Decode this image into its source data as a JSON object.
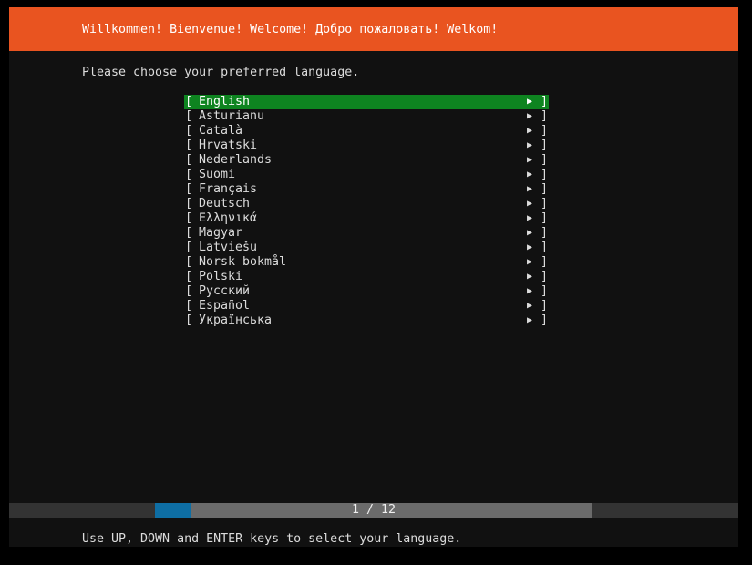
{
  "header": {
    "title": "Willkommen! Bienvenue! Welcome! Добро пожаловать! Welkom!"
  },
  "prompt": "Please choose your preferred language.",
  "languages": [
    {
      "label": "English",
      "selected": true
    },
    {
      "label": "Asturianu",
      "selected": false
    },
    {
      "label": "Català",
      "selected": false
    },
    {
      "label": "Hrvatski",
      "selected": false
    },
    {
      "label": "Nederlands",
      "selected": false
    },
    {
      "label": "Suomi",
      "selected": false
    },
    {
      "label": "Français",
      "selected": false
    },
    {
      "label": "Deutsch",
      "selected": false
    },
    {
      "label": "Ελληνικά",
      "selected": false
    },
    {
      "label": "Magyar",
      "selected": false
    },
    {
      "label": "Latviešu",
      "selected": false
    },
    {
      "label": "Norsk bokmål",
      "selected": false
    },
    {
      "label": "Polski",
      "selected": false
    },
    {
      "label": "Русский",
      "selected": false
    },
    {
      "label": "Español",
      "selected": false
    },
    {
      "label": "Українська",
      "selected": false
    }
  ],
  "row_glyphs": {
    "open_bracket": "[",
    "close_bracket": "]",
    "arrow": "▶"
  },
  "progress": {
    "label": "1 / 12",
    "fraction": 0.083
  },
  "footer": {
    "help": "Use UP, DOWN and ENTER keys to select your language."
  },
  "colors": {
    "header_bg": "#e95420",
    "selected_bg": "#0e8420",
    "progress_fill": "#0e6ea4",
    "background": "#111111"
  }
}
